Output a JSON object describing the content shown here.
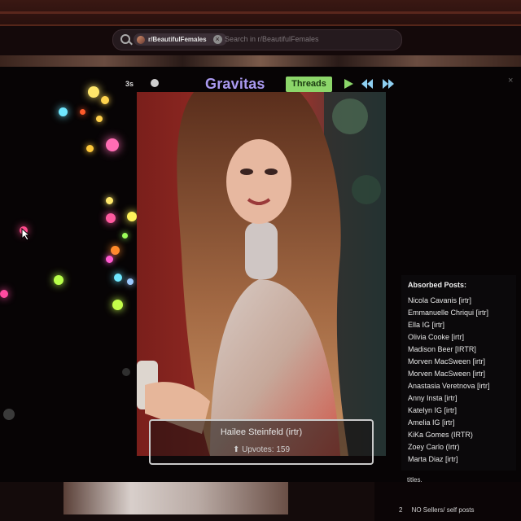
{
  "search": {
    "chip_label": "r/BeautifulFemales",
    "placeholder": "Search in r/BeautifulFemales",
    "clear_glyph": "×"
  },
  "player": {
    "time": "3s",
    "brand": "Gravitas",
    "threads_label": "Threads",
    "close_glyph": "×"
  },
  "caption": {
    "name": "Hailee Steinfeld (irtr)",
    "votes": "⬆ Upvotes: 159"
  },
  "absorbed": {
    "title": "Absorbed Posts:",
    "items": [
      "Nicola Cavanis [irtr]",
      "Emmanuelle Chriqui [irtr]",
      "Ella IG [irtr]",
      "Olivia Cooke [irtr]",
      "Madison Beer [IRTR]",
      "Morven MacSween [irtr]",
      "Morven MacSween [irtr]",
      "Anastasia Veretnova [irtr]",
      "Anny Insta [irtr]",
      "Katelyn IG [irtr]",
      "Amelia IG [irtr]",
      "KiKa Gomes (IRTR)",
      "Zoey Carlo (Irtr)",
      "Marta Diaz [irtr]"
    ]
  },
  "sidebar_below": {
    "text": "titles.",
    "rule_number": "2",
    "rule_text": "NO Sellers/ self posts"
  },
  "colors": {
    "brand": "#a999ef",
    "threads_bg": "#8cd66a",
    "controls": "#8fd0f2"
  }
}
